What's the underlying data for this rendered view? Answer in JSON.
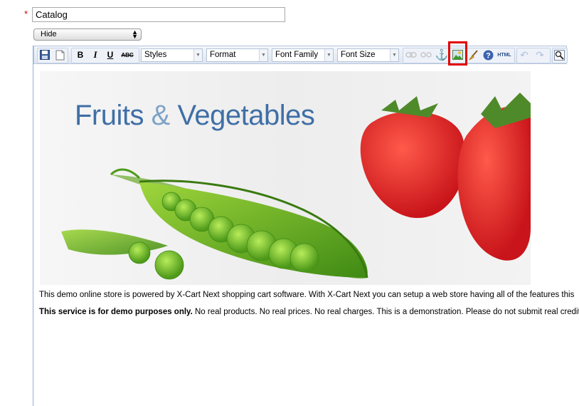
{
  "form": {
    "required_mark": "*",
    "title_value": "Catalog",
    "status_value": "Hide"
  },
  "toolbar": {
    "styles_label": "Styles",
    "format_label": "Format",
    "font_family_label": "Font Family",
    "font_size_label": "Font Size",
    "bold": "B",
    "italic": "I",
    "underline": "U",
    "strike": "ABC",
    "html_label": "HTML"
  },
  "banner": {
    "word1": "Fruits",
    "amp": "&",
    "word2": "Vegetables"
  },
  "content": {
    "paragraph1": "This demo online store is powered by X-Cart Next shopping cart software. With X-Cart Next you can setup a web store having all of the features this",
    "paragraph2_bold": "This service is for demo purposes only.",
    "paragraph2_rest": " No real products. No real prices. No real charges. This is a demonstration. Please do not submit real credit"
  },
  "colors": {
    "accent_blue": "#3f6fa6",
    "highlight_red": "#e10000"
  }
}
